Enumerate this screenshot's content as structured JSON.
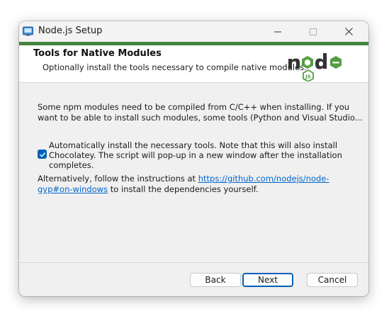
{
  "window": {
    "title": "Node.js Setup",
    "icons": {
      "app": "installer-icon",
      "minimize": "minimize-icon",
      "maximize": "maximize-icon",
      "close": "close-icon"
    }
  },
  "banner": {
    "title": "Tools for Native Modules",
    "subtitle": "Optionally install the tools necessary to compile native modules.",
    "logo_text": "node",
    "logo_badge": "JS",
    "accent_color": "#43853d"
  },
  "main": {
    "intro_line1": "Some npm modules need to be compiled from C/C++ when installing. If you",
    "intro_line2": "want to be able to install such modules, some tools (Python and Visual Studio...",
    "checkbox_checked": true,
    "checkbox_label": "Automatically install the necessary tools. Note that this will also install Chocolatey. The script will pop-up in a new window after the installation completes.",
    "alt_prefix": "Alternatively, follow the instructions at ",
    "alt_link": "https://github.com/nodejs/node-gyp#on-windows",
    "alt_suffix": " to install the dependencies yourself."
  },
  "footer": {
    "back_label": "Back",
    "next_label": "Next",
    "cancel_label": "Cancel"
  }
}
